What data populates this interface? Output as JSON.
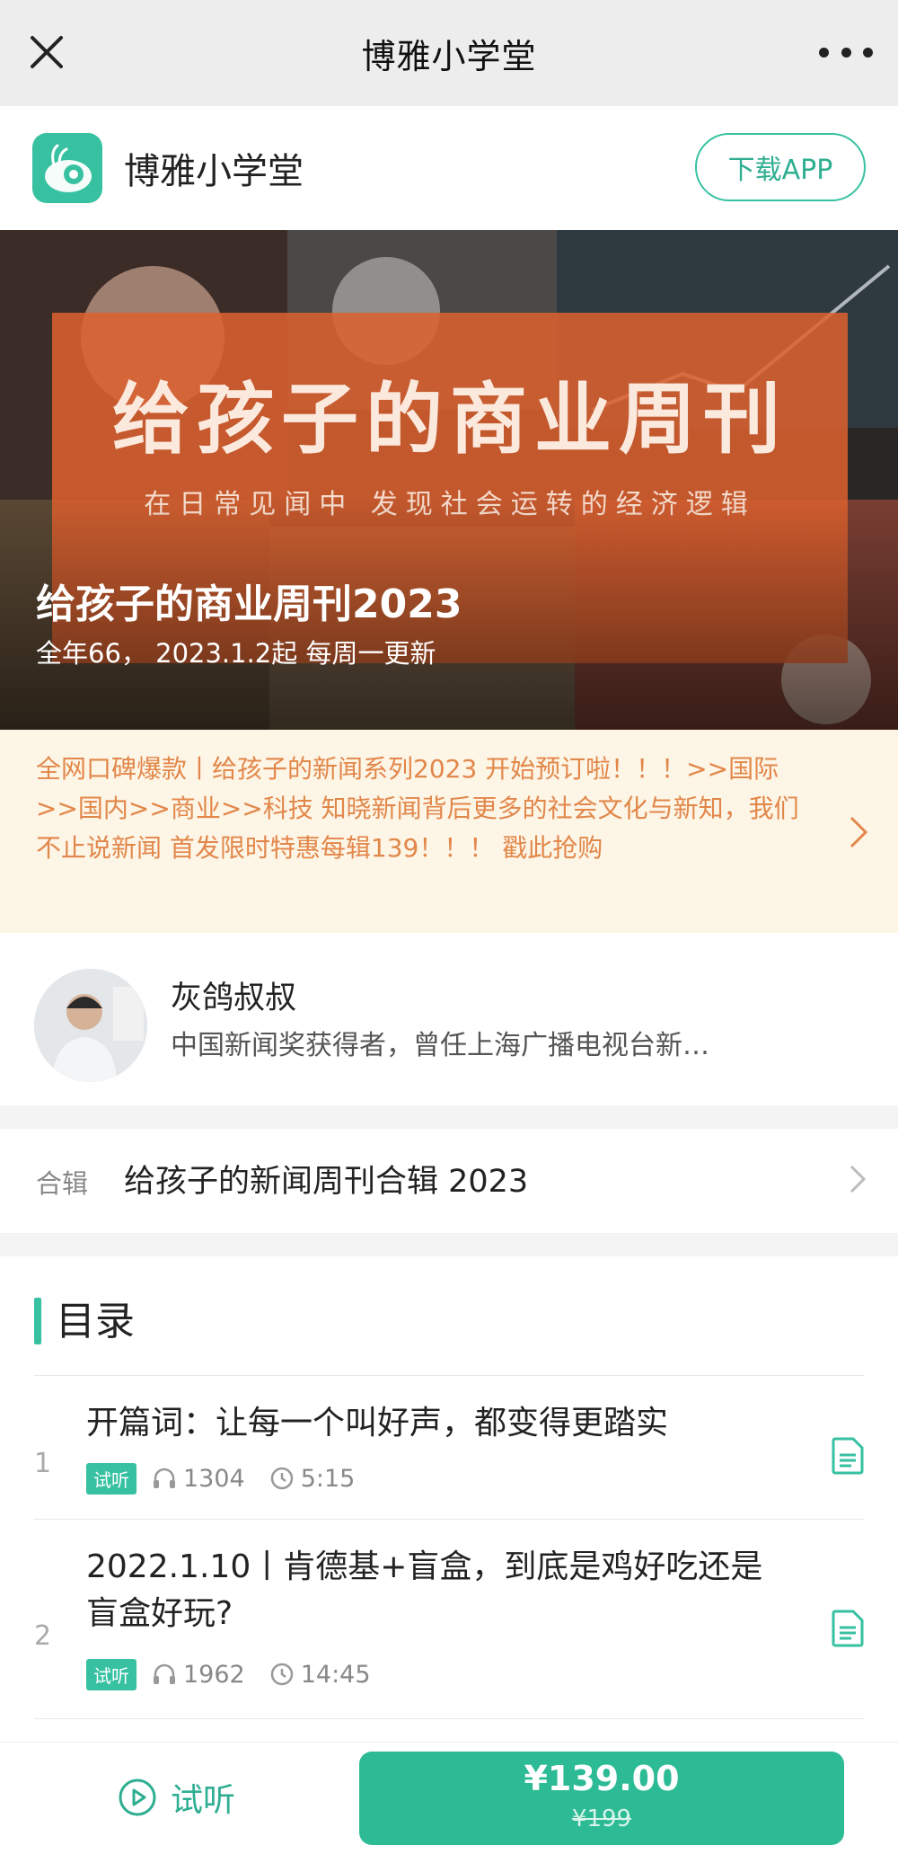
{
  "navbar": {
    "title": "博雅小学堂"
  },
  "appbar": {
    "name": "博雅小学堂",
    "download_label": "下载APP"
  },
  "banner": {
    "big_title": "给孩子的商业周刊",
    "tagline": "在日常见闻中 发现社会运转的经济逻辑",
    "course_title": "给孩子的商业周刊2023",
    "course_subtitle": "全年66， 2023.1.2起 每周一更新"
  },
  "notice": {
    "text": "全网口碑爆款丨给孩子的新闻系列2023 开始预订啦！！！>>国际>>国内>>商业>>科技 知晓新闻背后更多的社会文化与新知，我们不止说新闻 首发限时特惠每辑139！！！ 戳此抢购"
  },
  "author": {
    "name": "灰鸽叔叔",
    "description": "中国新闻奖获得者，曾任上海广播电视台新…"
  },
  "collection": {
    "tag": "合辑",
    "name": "给孩子的新闻周刊合辑 2023"
  },
  "catalog": {
    "title": "目录",
    "episodes": [
      {
        "index": "1",
        "title": "开篇词：让每一个叫好声，都变得更踏实",
        "tag": "试听",
        "plays": "1304",
        "duration": "5:15"
      },
      {
        "index": "2",
        "title": "2022.1.10丨肯德基+盲盒，到底是鸡好吃还是盲盒好玩?",
        "tag": "试听",
        "plays": "1962",
        "duration": "14:45"
      }
    ]
  },
  "bottom": {
    "trial_label": "试听",
    "price": "¥139.00",
    "original_price": "¥199"
  },
  "colors": {
    "accent": "#37c1a1",
    "notice_text": "#e2874a",
    "banner_orange": "#dd612f"
  },
  "icons": [
    "close-icon",
    "more-icon",
    "app-logo",
    "chevron-right-icon",
    "headphones-icon",
    "clock-icon",
    "document-icon",
    "play-circle-icon"
  ]
}
